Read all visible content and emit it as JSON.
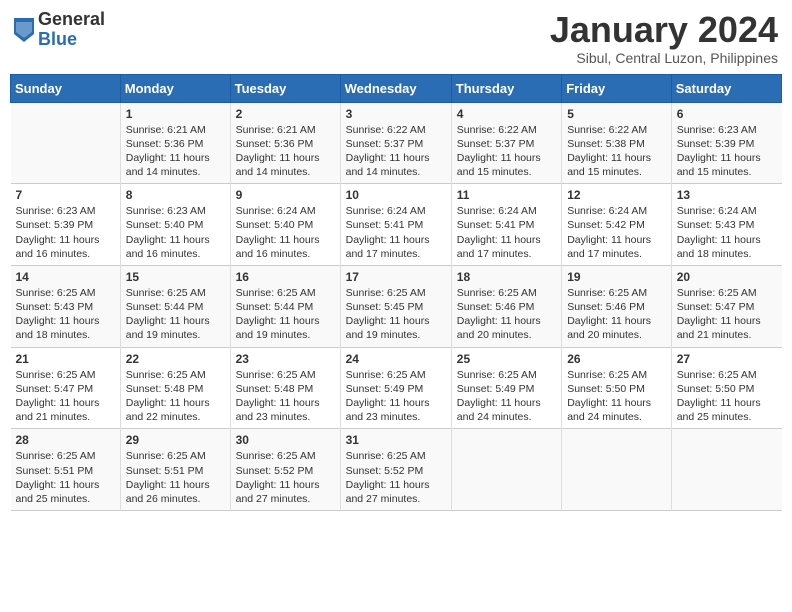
{
  "header": {
    "logo_general": "General",
    "logo_blue": "Blue",
    "month_title": "January 2024",
    "subtitle": "Sibul, Central Luzon, Philippines"
  },
  "days_of_week": [
    "Sunday",
    "Monday",
    "Tuesday",
    "Wednesday",
    "Thursday",
    "Friday",
    "Saturday"
  ],
  "weeks": [
    [
      {
        "day": "",
        "info": ""
      },
      {
        "day": "1",
        "info": "Sunrise: 6:21 AM\nSunset: 5:36 PM\nDaylight: 11 hours\nand 14 minutes."
      },
      {
        "day": "2",
        "info": "Sunrise: 6:21 AM\nSunset: 5:36 PM\nDaylight: 11 hours\nand 14 minutes."
      },
      {
        "day": "3",
        "info": "Sunrise: 6:22 AM\nSunset: 5:37 PM\nDaylight: 11 hours\nand 14 minutes."
      },
      {
        "day": "4",
        "info": "Sunrise: 6:22 AM\nSunset: 5:37 PM\nDaylight: 11 hours\nand 15 minutes."
      },
      {
        "day": "5",
        "info": "Sunrise: 6:22 AM\nSunset: 5:38 PM\nDaylight: 11 hours\nand 15 minutes."
      },
      {
        "day": "6",
        "info": "Sunrise: 6:23 AM\nSunset: 5:39 PM\nDaylight: 11 hours\nand 15 minutes."
      }
    ],
    [
      {
        "day": "7",
        "info": "Sunrise: 6:23 AM\nSunset: 5:39 PM\nDaylight: 11 hours\nand 16 minutes."
      },
      {
        "day": "8",
        "info": "Sunrise: 6:23 AM\nSunset: 5:40 PM\nDaylight: 11 hours\nand 16 minutes."
      },
      {
        "day": "9",
        "info": "Sunrise: 6:24 AM\nSunset: 5:40 PM\nDaylight: 11 hours\nand 16 minutes."
      },
      {
        "day": "10",
        "info": "Sunrise: 6:24 AM\nSunset: 5:41 PM\nDaylight: 11 hours\nand 17 minutes."
      },
      {
        "day": "11",
        "info": "Sunrise: 6:24 AM\nSunset: 5:41 PM\nDaylight: 11 hours\nand 17 minutes."
      },
      {
        "day": "12",
        "info": "Sunrise: 6:24 AM\nSunset: 5:42 PM\nDaylight: 11 hours\nand 17 minutes."
      },
      {
        "day": "13",
        "info": "Sunrise: 6:24 AM\nSunset: 5:43 PM\nDaylight: 11 hours\nand 18 minutes."
      }
    ],
    [
      {
        "day": "14",
        "info": "Sunrise: 6:25 AM\nSunset: 5:43 PM\nDaylight: 11 hours\nand 18 minutes."
      },
      {
        "day": "15",
        "info": "Sunrise: 6:25 AM\nSunset: 5:44 PM\nDaylight: 11 hours\nand 19 minutes."
      },
      {
        "day": "16",
        "info": "Sunrise: 6:25 AM\nSunset: 5:44 PM\nDaylight: 11 hours\nand 19 minutes."
      },
      {
        "day": "17",
        "info": "Sunrise: 6:25 AM\nSunset: 5:45 PM\nDaylight: 11 hours\nand 19 minutes."
      },
      {
        "day": "18",
        "info": "Sunrise: 6:25 AM\nSunset: 5:46 PM\nDaylight: 11 hours\nand 20 minutes."
      },
      {
        "day": "19",
        "info": "Sunrise: 6:25 AM\nSunset: 5:46 PM\nDaylight: 11 hours\nand 20 minutes."
      },
      {
        "day": "20",
        "info": "Sunrise: 6:25 AM\nSunset: 5:47 PM\nDaylight: 11 hours\nand 21 minutes."
      }
    ],
    [
      {
        "day": "21",
        "info": "Sunrise: 6:25 AM\nSunset: 5:47 PM\nDaylight: 11 hours\nand 21 minutes."
      },
      {
        "day": "22",
        "info": "Sunrise: 6:25 AM\nSunset: 5:48 PM\nDaylight: 11 hours\nand 22 minutes."
      },
      {
        "day": "23",
        "info": "Sunrise: 6:25 AM\nSunset: 5:48 PM\nDaylight: 11 hours\nand 23 minutes."
      },
      {
        "day": "24",
        "info": "Sunrise: 6:25 AM\nSunset: 5:49 PM\nDaylight: 11 hours\nand 23 minutes."
      },
      {
        "day": "25",
        "info": "Sunrise: 6:25 AM\nSunset: 5:49 PM\nDaylight: 11 hours\nand 24 minutes."
      },
      {
        "day": "26",
        "info": "Sunrise: 6:25 AM\nSunset: 5:50 PM\nDaylight: 11 hours\nand 24 minutes."
      },
      {
        "day": "27",
        "info": "Sunrise: 6:25 AM\nSunset: 5:50 PM\nDaylight: 11 hours\nand 25 minutes."
      }
    ],
    [
      {
        "day": "28",
        "info": "Sunrise: 6:25 AM\nSunset: 5:51 PM\nDaylight: 11 hours\nand 25 minutes."
      },
      {
        "day": "29",
        "info": "Sunrise: 6:25 AM\nSunset: 5:51 PM\nDaylight: 11 hours\nand 26 minutes."
      },
      {
        "day": "30",
        "info": "Sunrise: 6:25 AM\nSunset: 5:52 PM\nDaylight: 11 hours\nand 27 minutes."
      },
      {
        "day": "31",
        "info": "Sunrise: 6:25 AM\nSunset: 5:52 PM\nDaylight: 11 hours\nand 27 minutes."
      },
      {
        "day": "",
        "info": ""
      },
      {
        "day": "",
        "info": ""
      },
      {
        "day": "",
        "info": ""
      }
    ]
  ]
}
